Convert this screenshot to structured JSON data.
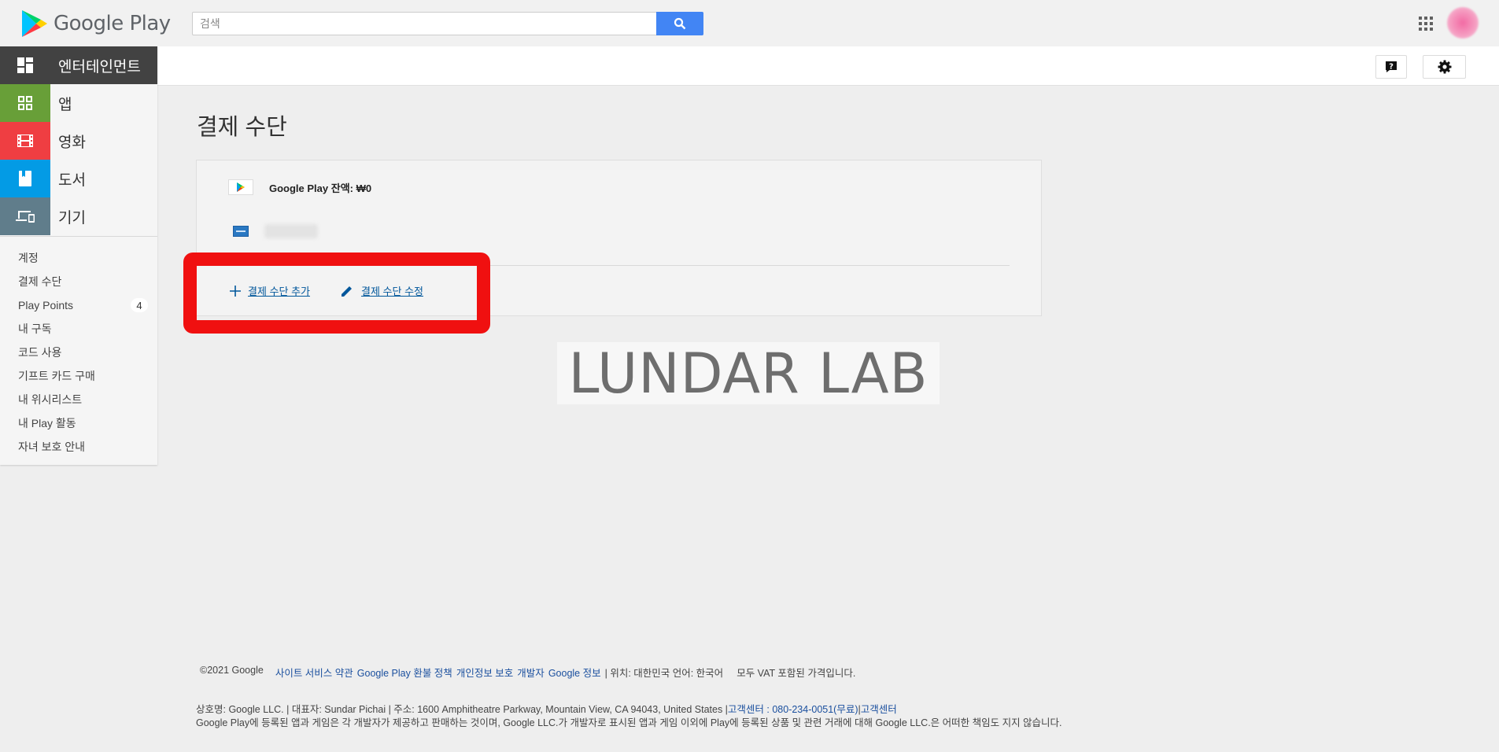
{
  "header": {
    "logo_text": "Google Play",
    "search_placeholder": "검색"
  },
  "sidebar": {
    "categories": [
      {
        "label": "엔터테인먼트",
        "color": "#424242"
      },
      {
        "label": "앱",
        "color": "#689f38"
      },
      {
        "label": "영화",
        "color": "#ef3e42"
      },
      {
        "label": "도서",
        "color": "#039be5"
      },
      {
        "label": "기기",
        "color": "#607d8b"
      }
    ],
    "menu": [
      {
        "label": "계정"
      },
      {
        "label": "결제 수단"
      },
      {
        "label": "Play Points",
        "badge": "4"
      },
      {
        "label": "내 구독"
      },
      {
        "label": "코드 사용"
      },
      {
        "label": "기프트 카드 구매"
      },
      {
        "label": "내 위시리스트"
      },
      {
        "label": "내 Play 활동"
      },
      {
        "label": "자녀 보호 안내"
      }
    ]
  },
  "main": {
    "title": "결제 수단",
    "balance_label": "Google Play 잔액: ₩0",
    "add_label": "결제 수단 추가",
    "edit_label": "결제 수단 수정",
    "watermark": "LUNDAR LAB",
    "highlight_color": "#f01010"
  },
  "footer": {
    "copyright": "©2021 Google",
    "links": [
      "사이트 서비스 약관",
      "Google Play 환불 정책",
      "개인정보 보호",
      "개발자",
      "Google 정보"
    ],
    "location": "| 위치: 대한민국 언어: 한국어",
    "vat": "모두 VAT 포함된 가격입니다.",
    "company": "상호명: Google LLC. | 대표자: Sundar Pichai | 주소: 1600 Amphitheatre Parkway, Mountain View, CA 94043, United States |",
    "support_link": "고객센터 : 080-234-0051(무료)",
    "support_link2": "고객센터",
    "disclaimer": "Google Play에 등록된 앱과 게임은 각 개발자가 제공하고 판매하는 것이며, Google LLC.가 개발자로 표시된 앱과 게임 이외에 Play에 등록된 상품 및 관련 거래에 대해 Google LLC.은 어떠한 책임도 지지 않습니다."
  }
}
